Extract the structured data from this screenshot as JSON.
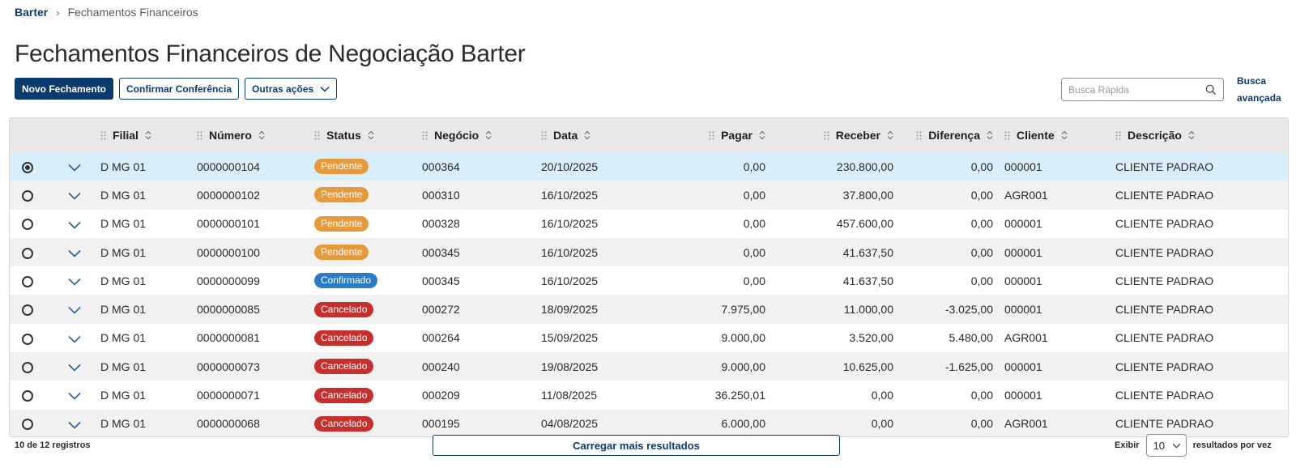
{
  "breadcrumb": {
    "root": "Barter",
    "separator": "›",
    "current": "Fechamentos Financeiros"
  },
  "page": {
    "title": "Fechamentos Financeiros de Negociação Barter"
  },
  "toolbar": {
    "new_label": "Novo Fechamento",
    "confirm_label": "Confirmar Conferência",
    "more_label": "Outras ações"
  },
  "search": {
    "placeholder": "Busca Rápida",
    "advanced_label": "Busca avançada"
  },
  "table": {
    "columns": [
      "Filial",
      "Número",
      "Status",
      "Negócio",
      "Data",
      "Pagar",
      "Receber",
      "Diferença",
      "Cliente",
      "Descrição"
    ],
    "status_colors": {
      "Pendente": "#e79a3c",
      "Confirmado": "#2a7cc7",
      "Cancelado": "#c5302e"
    },
    "rows": [
      {
        "filial": "D MG 01",
        "numero": "0000000104",
        "status": "Pendente",
        "negocio": "000364",
        "data": "20/10/2025",
        "pagar": "0,00",
        "receber": "230.800,00",
        "diferenca": "0,00",
        "cliente": "000001",
        "descricao": "CLIENTE PADRAO",
        "selected": true
      },
      {
        "filial": "D MG 01",
        "numero": "0000000102",
        "status": "Pendente",
        "negocio": "000310",
        "data": "16/10/2025",
        "pagar": "0,00",
        "receber": "37.800,00",
        "diferenca": "0,00",
        "cliente": "AGR001",
        "descricao": "CLIENTE PADRAO",
        "selected": false
      },
      {
        "filial": "D MG 01",
        "numero": "0000000101",
        "status": "Pendente",
        "negocio": "000328",
        "data": "16/10/2025",
        "pagar": "0,00",
        "receber": "457.600,00",
        "diferenca": "0,00",
        "cliente": "000001",
        "descricao": "CLIENTE PADRAO",
        "selected": false
      },
      {
        "filial": "D MG 01",
        "numero": "0000000100",
        "status": "Pendente",
        "negocio": "000345",
        "data": "16/10/2025",
        "pagar": "0,00",
        "receber": "41.637,50",
        "diferenca": "0,00",
        "cliente": "000001",
        "descricao": "CLIENTE PADRAO",
        "selected": false
      },
      {
        "filial": "D MG 01",
        "numero": "0000000099",
        "status": "Confirmado",
        "negocio": "000345",
        "data": "16/10/2025",
        "pagar": "0,00",
        "receber": "41.637,50",
        "diferenca": "0,00",
        "cliente": "000001",
        "descricao": "CLIENTE PADRAO",
        "selected": false
      },
      {
        "filial": "D MG 01",
        "numero": "0000000085",
        "status": "Cancelado",
        "negocio": "000272",
        "data": "18/09/2025",
        "pagar": "7.975,00",
        "receber": "11.000,00",
        "diferenca": "-3.025,00",
        "cliente": "000001",
        "descricao": "CLIENTE PADRAO",
        "selected": false
      },
      {
        "filial": "D MG 01",
        "numero": "0000000081",
        "status": "Cancelado",
        "negocio": "000264",
        "data": "15/09/2025",
        "pagar": "9.000,00",
        "receber": "3.520,00",
        "diferenca": "5.480,00",
        "cliente": "AGR001",
        "descricao": "CLIENTE PADRAO",
        "selected": false
      },
      {
        "filial": "D MG 01",
        "numero": "0000000073",
        "status": "Cancelado",
        "negocio": "000240",
        "data": "19/08/2025",
        "pagar": "9.000,00",
        "receber": "10.625,00",
        "diferenca": "-1.625,00",
        "cliente": "000001",
        "descricao": "CLIENTE PADRAO",
        "selected": false
      },
      {
        "filial": "D MG 01",
        "numero": "0000000071",
        "status": "Cancelado",
        "negocio": "000209",
        "data": "11/08/2025",
        "pagar": "36.250,01",
        "receber": "0,00",
        "diferenca": "0,00",
        "cliente": "000001",
        "descricao": "CLIENTE PADRAO",
        "selected": false
      },
      {
        "filial": "D MG 01",
        "numero": "0000000068",
        "status": "Cancelado",
        "negocio": "000195",
        "data": "04/08/2025",
        "pagar": "6.000,00",
        "receber": "0,00",
        "diferenca": "0,00",
        "cliente": "AGR001",
        "descricao": "CLIENTE PADRAO",
        "selected": false
      }
    ]
  },
  "footer": {
    "count_label": "10 de 12 registros",
    "load_more_label": "Carregar mais resultados",
    "show_label": "Exibir",
    "page_size": "10",
    "per_page_label": "resultados por vez"
  }
}
